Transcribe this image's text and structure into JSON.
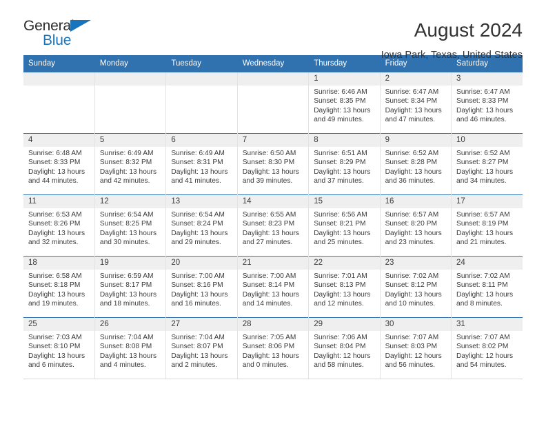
{
  "brand": {
    "name_part1": "General",
    "name_part2": "Blue",
    "accent_color": "#1a74bb"
  },
  "header": {
    "title": "August 2024",
    "location": "Iowa Park, Texas, United States"
  },
  "theme": {
    "header_bar_color": "#3071b0",
    "daynum_band_color": "#efefef",
    "text_color": "#333333"
  },
  "calendar": {
    "weekday_headers": [
      "Sunday",
      "Monday",
      "Tuesday",
      "Wednesday",
      "Thursday",
      "Friday",
      "Saturday"
    ],
    "weeks": [
      [
        {
          "day": "",
          "empty": true,
          "sunrise": "",
          "sunset": "",
          "daylight_line1": "",
          "daylight_line2": ""
        },
        {
          "day": "",
          "empty": true,
          "sunrise": "",
          "sunset": "",
          "daylight_line1": "",
          "daylight_line2": ""
        },
        {
          "day": "",
          "empty": true,
          "sunrise": "",
          "sunset": "",
          "daylight_line1": "",
          "daylight_line2": ""
        },
        {
          "day": "",
          "empty": true,
          "sunrise": "",
          "sunset": "",
          "daylight_line1": "",
          "daylight_line2": ""
        },
        {
          "day": "1",
          "empty": false,
          "sunrise": "Sunrise: 6:46 AM",
          "sunset": "Sunset: 8:35 PM",
          "daylight_line1": "Daylight: 13 hours",
          "daylight_line2": "and 49 minutes."
        },
        {
          "day": "2",
          "empty": false,
          "sunrise": "Sunrise: 6:47 AM",
          "sunset": "Sunset: 8:34 PM",
          "daylight_line1": "Daylight: 13 hours",
          "daylight_line2": "and 47 minutes."
        },
        {
          "day": "3",
          "empty": false,
          "sunrise": "Sunrise: 6:47 AM",
          "sunset": "Sunset: 8:33 PM",
          "daylight_line1": "Daylight: 13 hours",
          "daylight_line2": "and 46 minutes."
        }
      ],
      [
        {
          "day": "4",
          "empty": false,
          "sunrise": "Sunrise: 6:48 AM",
          "sunset": "Sunset: 8:33 PM",
          "daylight_line1": "Daylight: 13 hours",
          "daylight_line2": "and 44 minutes."
        },
        {
          "day": "5",
          "empty": false,
          "sunrise": "Sunrise: 6:49 AM",
          "sunset": "Sunset: 8:32 PM",
          "daylight_line1": "Daylight: 13 hours",
          "daylight_line2": "and 42 minutes."
        },
        {
          "day": "6",
          "empty": false,
          "sunrise": "Sunrise: 6:49 AM",
          "sunset": "Sunset: 8:31 PM",
          "daylight_line1": "Daylight: 13 hours",
          "daylight_line2": "and 41 minutes."
        },
        {
          "day": "7",
          "empty": false,
          "sunrise": "Sunrise: 6:50 AM",
          "sunset": "Sunset: 8:30 PM",
          "daylight_line1": "Daylight: 13 hours",
          "daylight_line2": "and 39 minutes."
        },
        {
          "day": "8",
          "empty": false,
          "sunrise": "Sunrise: 6:51 AM",
          "sunset": "Sunset: 8:29 PM",
          "daylight_line1": "Daylight: 13 hours",
          "daylight_line2": "and 37 minutes."
        },
        {
          "day": "9",
          "empty": false,
          "sunrise": "Sunrise: 6:52 AM",
          "sunset": "Sunset: 8:28 PM",
          "daylight_line1": "Daylight: 13 hours",
          "daylight_line2": "and 36 minutes."
        },
        {
          "day": "10",
          "empty": false,
          "sunrise": "Sunrise: 6:52 AM",
          "sunset": "Sunset: 8:27 PM",
          "daylight_line1": "Daylight: 13 hours",
          "daylight_line2": "and 34 minutes."
        }
      ],
      [
        {
          "day": "11",
          "empty": false,
          "sunrise": "Sunrise: 6:53 AM",
          "sunset": "Sunset: 8:26 PM",
          "daylight_line1": "Daylight: 13 hours",
          "daylight_line2": "and 32 minutes."
        },
        {
          "day": "12",
          "empty": false,
          "sunrise": "Sunrise: 6:54 AM",
          "sunset": "Sunset: 8:25 PM",
          "daylight_line1": "Daylight: 13 hours",
          "daylight_line2": "and 30 minutes."
        },
        {
          "day": "13",
          "empty": false,
          "sunrise": "Sunrise: 6:54 AM",
          "sunset": "Sunset: 8:24 PM",
          "daylight_line1": "Daylight: 13 hours",
          "daylight_line2": "and 29 minutes."
        },
        {
          "day": "14",
          "empty": false,
          "sunrise": "Sunrise: 6:55 AM",
          "sunset": "Sunset: 8:23 PM",
          "daylight_line1": "Daylight: 13 hours",
          "daylight_line2": "and 27 minutes."
        },
        {
          "day": "15",
          "empty": false,
          "sunrise": "Sunrise: 6:56 AM",
          "sunset": "Sunset: 8:21 PM",
          "daylight_line1": "Daylight: 13 hours",
          "daylight_line2": "and 25 minutes."
        },
        {
          "day": "16",
          "empty": false,
          "sunrise": "Sunrise: 6:57 AM",
          "sunset": "Sunset: 8:20 PM",
          "daylight_line1": "Daylight: 13 hours",
          "daylight_line2": "and 23 minutes."
        },
        {
          "day": "17",
          "empty": false,
          "sunrise": "Sunrise: 6:57 AM",
          "sunset": "Sunset: 8:19 PM",
          "daylight_line1": "Daylight: 13 hours",
          "daylight_line2": "and 21 minutes."
        }
      ],
      [
        {
          "day": "18",
          "empty": false,
          "sunrise": "Sunrise: 6:58 AM",
          "sunset": "Sunset: 8:18 PM",
          "daylight_line1": "Daylight: 13 hours",
          "daylight_line2": "and 19 minutes."
        },
        {
          "day": "19",
          "empty": false,
          "sunrise": "Sunrise: 6:59 AM",
          "sunset": "Sunset: 8:17 PM",
          "daylight_line1": "Daylight: 13 hours",
          "daylight_line2": "and 18 minutes."
        },
        {
          "day": "20",
          "empty": false,
          "sunrise": "Sunrise: 7:00 AM",
          "sunset": "Sunset: 8:16 PM",
          "daylight_line1": "Daylight: 13 hours",
          "daylight_line2": "and 16 minutes."
        },
        {
          "day": "21",
          "empty": false,
          "sunrise": "Sunrise: 7:00 AM",
          "sunset": "Sunset: 8:14 PM",
          "daylight_line1": "Daylight: 13 hours",
          "daylight_line2": "and 14 minutes."
        },
        {
          "day": "22",
          "empty": false,
          "sunrise": "Sunrise: 7:01 AM",
          "sunset": "Sunset: 8:13 PM",
          "daylight_line1": "Daylight: 13 hours",
          "daylight_line2": "and 12 minutes."
        },
        {
          "day": "23",
          "empty": false,
          "sunrise": "Sunrise: 7:02 AM",
          "sunset": "Sunset: 8:12 PM",
          "daylight_line1": "Daylight: 13 hours",
          "daylight_line2": "and 10 minutes."
        },
        {
          "day": "24",
          "empty": false,
          "sunrise": "Sunrise: 7:02 AM",
          "sunset": "Sunset: 8:11 PM",
          "daylight_line1": "Daylight: 13 hours",
          "daylight_line2": "and 8 minutes."
        }
      ],
      [
        {
          "day": "25",
          "empty": false,
          "sunrise": "Sunrise: 7:03 AM",
          "sunset": "Sunset: 8:10 PM",
          "daylight_line1": "Daylight: 13 hours",
          "daylight_line2": "and 6 minutes."
        },
        {
          "day": "26",
          "empty": false,
          "sunrise": "Sunrise: 7:04 AM",
          "sunset": "Sunset: 8:08 PM",
          "daylight_line1": "Daylight: 13 hours",
          "daylight_line2": "and 4 minutes."
        },
        {
          "day": "27",
          "empty": false,
          "sunrise": "Sunrise: 7:04 AM",
          "sunset": "Sunset: 8:07 PM",
          "daylight_line1": "Daylight: 13 hours",
          "daylight_line2": "and 2 minutes."
        },
        {
          "day": "28",
          "empty": false,
          "sunrise": "Sunrise: 7:05 AM",
          "sunset": "Sunset: 8:06 PM",
          "daylight_line1": "Daylight: 13 hours",
          "daylight_line2": "and 0 minutes."
        },
        {
          "day": "29",
          "empty": false,
          "sunrise": "Sunrise: 7:06 AM",
          "sunset": "Sunset: 8:04 PM",
          "daylight_line1": "Daylight: 12 hours",
          "daylight_line2": "and 58 minutes."
        },
        {
          "day": "30",
          "empty": false,
          "sunrise": "Sunrise: 7:07 AM",
          "sunset": "Sunset: 8:03 PM",
          "daylight_line1": "Daylight: 12 hours",
          "daylight_line2": "and 56 minutes."
        },
        {
          "day": "31",
          "empty": false,
          "sunrise": "Sunrise: 7:07 AM",
          "sunset": "Sunset: 8:02 PM",
          "daylight_line1": "Daylight: 12 hours",
          "daylight_line2": "and 54 minutes."
        }
      ]
    ]
  }
}
